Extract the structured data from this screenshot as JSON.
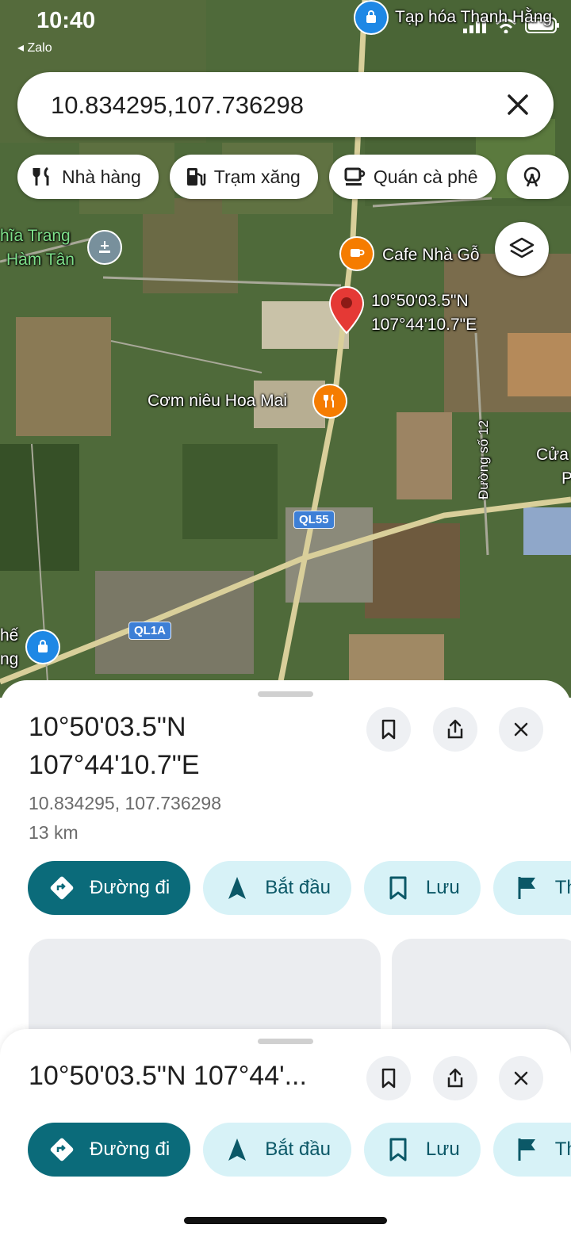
{
  "status_bar": {
    "time": "10:40",
    "back_app": "◂ Zalo"
  },
  "search": {
    "value": "10.834295,107.736298"
  },
  "chips": [
    {
      "label": "Nhà hàng",
      "icon": "fork-knife-icon"
    },
    {
      "label": "Trạm xăng",
      "icon": "gas-station-icon"
    },
    {
      "label": "Quán cà phê",
      "icon": "coffee-cup-icon"
    },
    {
      "label": "",
      "icon": "ferris-wheel-icon"
    }
  ],
  "map": {
    "labels": {
      "top_store": "Tạp hóa Thanh Hằng",
      "cemetery_1": "hĩa Trang",
      "cemetery_2": "Hàm Tân",
      "cafe": "Cafe Nhà Gỗ",
      "pin_lat": "10°50'03.5\"N",
      "pin_lng": "107°44'10.7\"E",
      "restaurant": "Cơm niêu Hoa Mai",
      "road_12": "Đường số 12",
      "right_edge_1": "Cửa",
      "right_edge_2": "P",
      "left_edge_1": "hế",
      "left_edge_2": "ng"
    },
    "shields": {
      "ql55": "QL55",
      "ql1a": "QL1A"
    },
    "colors": {
      "pin": "#e53935",
      "cafe_poi": "#f57c00",
      "shop_poi": "#1e88e5",
      "park_poi": "#78909c"
    }
  },
  "place": {
    "title_line1": "10°50'03.5\"N",
    "title_line2": "107°44'10.7\"E",
    "coords": "10.834295, 107.736298",
    "distance": "13 km",
    "title_collapsed": "10°50'03.5\"N 107°44'..."
  },
  "actions": {
    "directions": "Đường đi",
    "start": "Bắt đầu",
    "save": "Lưu",
    "more": "Th"
  },
  "colors": {
    "primary": "#0b6b7a",
    "tonal": "#d7f2f7",
    "on_tonal": "#0b5867"
  }
}
